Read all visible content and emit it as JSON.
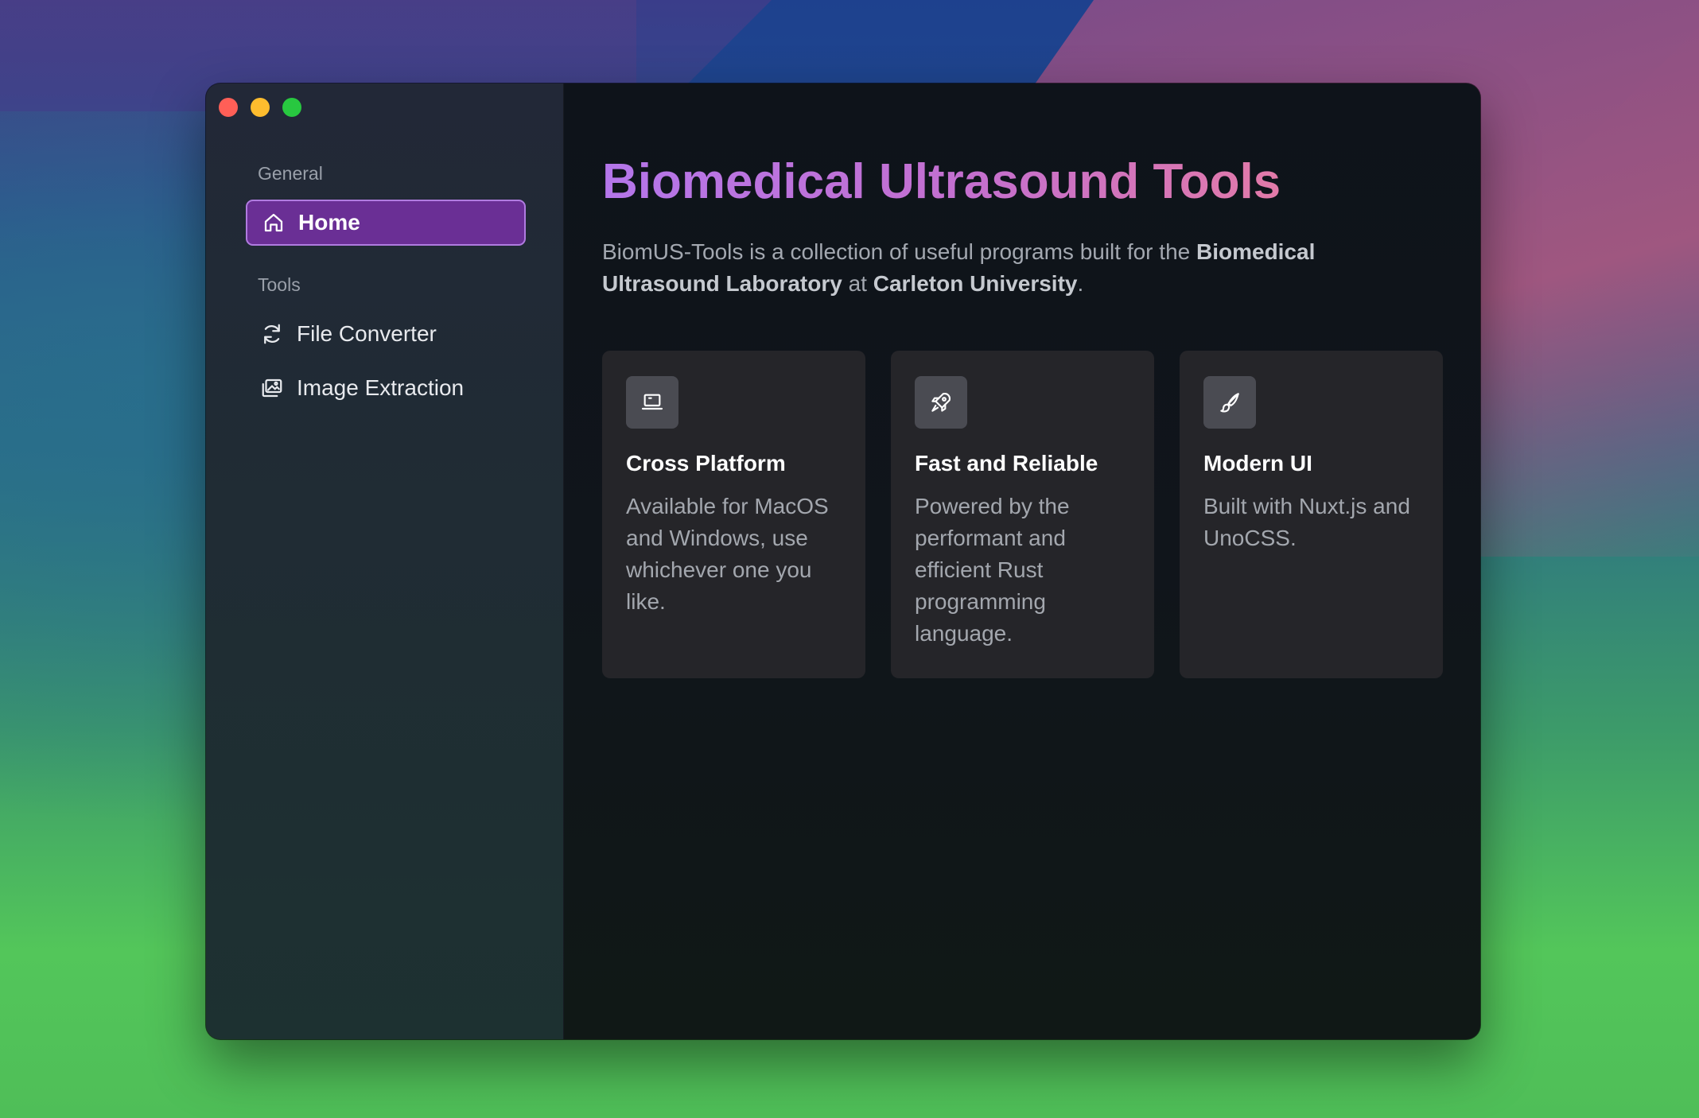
{
  "sidebar": {
    "sections": [
      {
        "label": "General",
        "items": [
          {
            "label": "Home",
            "icon": "home-icon",
            "active": true
          }
        ]
      },
      {
        "label": "Tools",
        "items": [
          {
            "label": "File Converter",
            "icon": "refresh-icon",
            "active": false
          },
          {
            "label": "Image Extraction",
            "icon": "images-icon",
            "active": false
          }
        ]
      }
    ]
  },
  "main": {
    "title": "Biomedical Ultrasound Tools",
    "description": {
      "part1": "BiomUS-Tools is a collection of useful programs built for the ",
      "bold1": "Biomedical Ultrasound Laboratory",
      "part2": " at ",
      "bold2": "Carleton University",
      "part3": "."
    },
    "cards": [
      {
        "icon": "laptop-icon",
        "title": "Cross Platform",
        "text": "Available for MacOS and Windows, use whichever one you like."
      },
      {
        "icon": "rocket-icon",
        "title": "Fast and Reliable",
        "text": "Powered by the performant and efficient Rust programming language."
      },
      {
        "icon": "brush-icon",
        "title": "Modern UI",
        "text": "Built with Nuxt.js and UnoCSS."
      }
    ]
  },
  "colors": {
    "accent": "#6a2f95",
    "accent_border": "#b07be0",
    "title_gradient_start": "#b476ea",
    "title_gradient_end": "#e27aa8"
  }
}
